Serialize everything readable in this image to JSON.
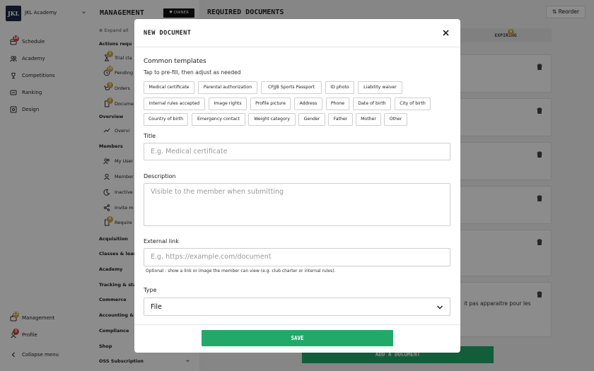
{
  "app": {
    "logo_text": "JKL",
    "org_name": "JKL Academy"
  },
  "sidebar": {
    "items": [
      {
        "label": "Schedule",
        "badge": "10"
      },
      {
        "label": "Academy"
      },
      {
        "label": "Competitions"
      },
      {
        "label": "Ranking"
      },
      {
        "label": "Design"
      }
    ],
    "bottom": [
      {
        "label": "Management",
        "badge": "12"
      },
      {
        "label": "Profile",
        "badge": "3"
      }
    ],
    "collapse_label": "Collapse menu"
  },
  "submenu": {
    "title": "MANAGEMENT",
    "role_badge": "OWNER",
    "expand_all": "Expand all",
    "actions_title": "Actions requ",
    "actions": [
      {
        "label": "Trial cla",
        "badge": "3"
      },
      {
        "label": "Pending",
        "badge": "10"
      },
      {
        "label": "Orders",
        "badge": "3"
      },
      {
        "label": "Docume",
        "badge": "2"
      }
    ],
    "overview_title": "Overview",
    "overview_items": [
      {
        "label": "Overvi"
      }
    ],
    "members_title": "Members",
    "members_items": [
      {
        "label": "My User"
      },
      {
        "label": "Member"
      },
      {
        "label": "Inactive"
      },
      {
        "label": "Invite m"
      },
      {
        "label": "Require",
        "badge": "4"
      }
    ],
    "sections": [
      "Acquisition",
      "Classes & lear",
      "Academy",
      "Tracking & sta",
      "Commerce",
      "Accounting & f",
      "Compliance",
      "Shop",
      "OSS Subscription"
    ]
  },
  "main": {
    "page_title": "REQUIRED DOCUMENTS",
    "reorder_label": "Reorder",
    "tab_expiring": "EXPIRING",
    "tab_expiring_badge": "4",
    "partial_text_1": "it pas apparaitre pour les",
    "add_button": "ADD A DOCUMENT"
  },
  "modal": {
    "title": "NEW DOCUMENT",
    "templates_title": "Common templates",
    "templates_hint": "Tap to pre-fill, then adjust as needed",
    "templates": [
      "Medical certificate",
      "Parental authorization",
      "CFJJB Sports Passport",
      "ID photo",
      "Liability waiver",
      "Internal rules accepted",
      "Image rights",
      "Profile picture",
      "Address",
      "Phone",
      "Date of birth",
      "City of birth",
      "Country of birth",
      "Emergency contact",
      "Weight category",
      "Gender",
      "Father",
      "Mother",
      "Other"
    ],
    "title_label": "Title",
    "title_placeholder": "E.g. Medical certificate",
    "description_label": "Description",
    "description_placeholder": "Visible to the member when submitting",
    "link_label": "External link",
    "link_placeholder": "E.g. https://example.com/document",
    "link_help": "Optional : show a link or image the member can view (e.g. club charter or internal rules).",
    "type_label": "Type",
    "type_value": "File",
    "save_label": "SAVE"
  },
  "colors": {
    "accent": "#22a96a",
    "badge": "#d4a843",
    "badge_alert": "#d64545",
    "logo_bg": "#1c2b45"
  }
}
